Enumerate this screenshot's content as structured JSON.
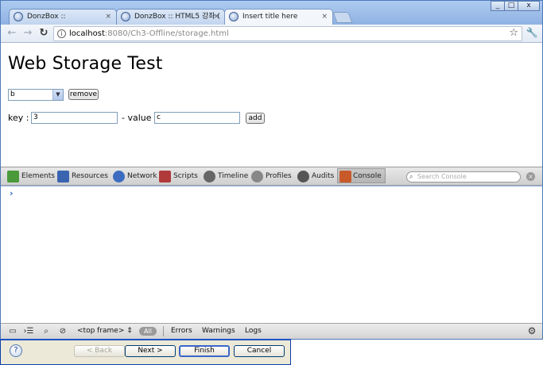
{
  "browser": {
    "tabs": [
      {
        "label": "DonzBox ::",
        "active": false
      },
      {
        "label": "DonzBox :: HTML5 강좌 (",
        "active": false
      },
      {
        "label": "Insert title here",
        "active": true
      }
    ],
    "tab_close_glyph": "×",
    "url_host": "localhost",
    "url_rest": ":8080/Ch3-Offline/storage.html",
    "window_buttons": {
      "min": "_",
      "max": "□",
      "close": "x"
    }
  },
  "page": {
    "title": "Web Storage Test",
    "key_select_value": "b",
    "remove_label": "remove",
    "key_label": "key :",
    "key_value": "3",
    "value_label": "- value",
    "value_value": "c",
    "add_label": "add"
  },
  "devtools": {
    "tabs": [
      {
        "label": "Elements",
        "icon": "elements-icon",
        "color": "#4a9a3a"
      },
      {
        "label": "Resources",
        "icon": "resources-icon",
        "color": "#3a64b0"
      },
      {
        "label": "Network",
        "icon": "network-icon",
        "color": "#3c6cc0"
      },
      {
        "label": "Scripts",
        "icon": "scripts-icon",
        "color": "#b03a3a"
      },
      {
        "label": "Timeline",
        "icon": "timeline-icon",
        "color": "#666666"
      },
      {
        "label": "Profiles",
        "icon": "profiles-icon",
        "color": "#888888"
      },
      {
        "label": "Audits",
        "icon": "audits-icon",
        "color": "#555555"
      },
      {
        "label": "Console",
        "icon": "console-icon",
        "color": "#c85a2a",
        "selected": true
      }
    ],
    "search_placeholder": "Search Console",
    "prompt": "›",
    "status_bar": {
      "frame": "<top frame> ⇕",
      "filter_all": "All",
      "filters": [
        "Errors",
        "Warnings",
        "Logs"
      ]
    }
  },
  "dialog": {
    "help": "?",
    "back_label": "< Back",
    "next_label": "Next >",
    "finish_label": "Finish",
    "cancel_label": "Cancel"
  }
}
